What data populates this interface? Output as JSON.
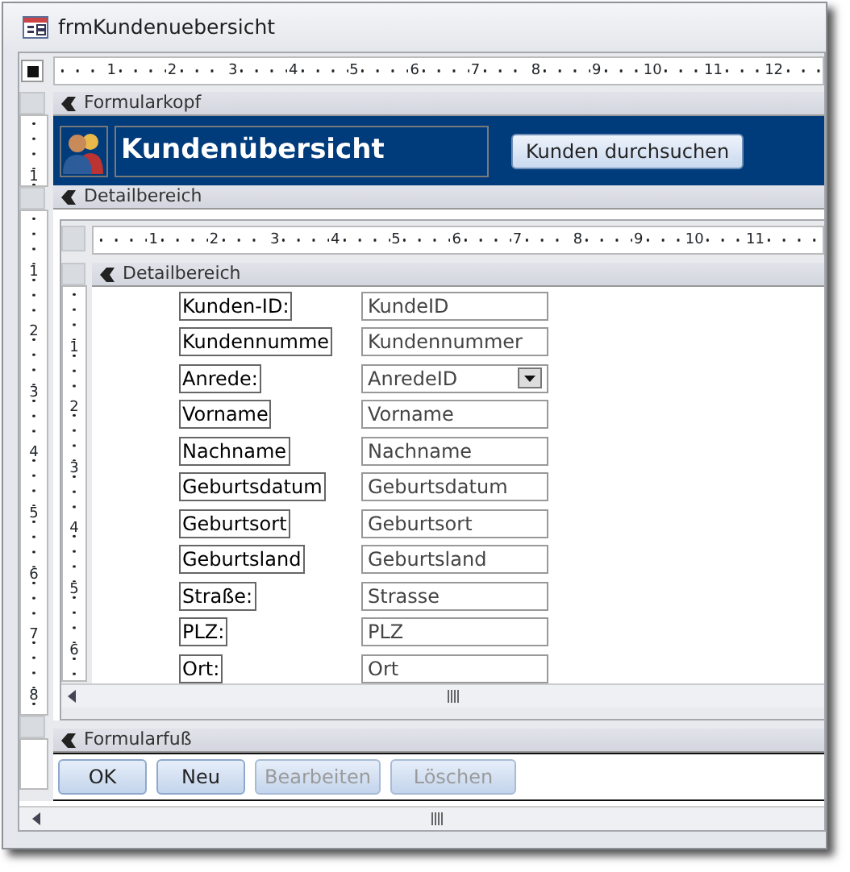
{
  "window": {
    "title": "frmKundenuebersicht"
  },
  "ruler": {
    "marks": [
      "1",
      "2",
      "3",
      "4",
      "5",
      "6",
      "7",
      "8",
      "9",
      "10",
      "11",
      "12"
    ]
  },
  "vertical_ruler": {
    "header_marks": [
      "1"
    ],
    "detail_marks": [
      "1",
      "2",
      "3",
      "4",
      "5",
      "6",
      "7",
      "8"
    ]
  },
  "form_header": {
    "band_label": "Formularkopf",
    "title": "Kundenübersicht",
    "button": "Kunden durchsuchen"
  },
  "detail": {
    "band_label": "Detailbereich",
    "subform": {
      "ruler_marks": [
        "1",
        "2",
        "3",
        "4",
        "5",
        "6",
        "7",
        "8",
        "9",
        "10",
        "11"
      ],
      "vertical_marks": [
        "1",
        "2",
        "3",
        "4",
        "5",
        "6"
      ],
      "band_label": "Detailbereich",
      "fields": [
        {
          "label": "Kunden-ID:",
          "control": "KundeID",
          "kind": "textbox"
        },
        {
          "label": "Kundennumme",
          "control": "Kundennummer",
          "kind": "textbox"
        },
        {
          "label": "Anrede:",
          "control": "AnredeID",
          "kind": "combobox"
        },
        {
          "label": "Vorname",
          "control": "Vorname",
          "kind": "textbox"
        },
        {
          "label": "Nachname",
          "control": "Nachname",
          "kind": "textbox"
        },
        {
          "label": "Geburtsdatum",
          "control": "Geburtsdatum",
          "kind": "textbox"
        },
        {
          "label": "Geburtsort",
          "control": "Geburtsort",
          "kind": "textbox"
        },
        {
          "label": "Geburtsland",
          "control": "Geburtsland",
          "kind": "textbox"
        },
        {
          "label": "Straße:",
          "control": "Strasse",
          "kind": "textbox"
        },
        {
          "label": "PLZ:",
          "control": "PLZ",
          "kind": "textbox"
        },
        {
          "label": "Ort:",
          "control": "Ort",
          "kind": "textbox"
        }
      ]
    }
  },
  "form_footer": {
    "band_label": "Formularfuß",
    "buttons": [
      {
        "label": "OK",
        "disabled": false
      },
      {
        "label": "Neu",
        "disabled": false
      },
      {
        "label": "Bearbeiten",
        "disabled": true
      },
      {
        "label": "Löschen",
        "disabled": true
      }
    ]
  }
}
